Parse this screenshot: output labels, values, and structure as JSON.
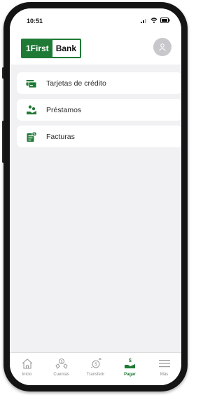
{
  "status": {
    "time": "10:51"
  },
  "header": {
    "logo_primary": "1First",
    "logo_secondary": "Bank"
  },
  "menu": [
    {
      "label": "Tarjetas de crédito",
      "icon": "credit-card-icon"
    },
    {
      "label": "Préstamos",
      "icon": "loan-icon"
    },
    {
      "label": "Facturas",
      "icon": "bill-icon"
    }
  ],
  "tabs": [
    {
      "label": "Inicio",
      "icon": "home-icon",
      "active": false
    },
    {
      "label": "Cuentas",
      "icon": "accounts-icon",
      "active": false
    },
    {
      "label": "Transferir",
      "icon": "transfer-icon",
      "active": false
    },
    {
      "label": "Pagar",
      "icon": "pay-icon",
      "active": true
    },
    {
      "label": "Más",
      "icon": "menu-icon",
      "active": false
    }
  ],
  "colors": {
    "brand_green": "#1f7a36",
    "background": "#f1f1f4",
    "inactive": "#888888"
  }
}
